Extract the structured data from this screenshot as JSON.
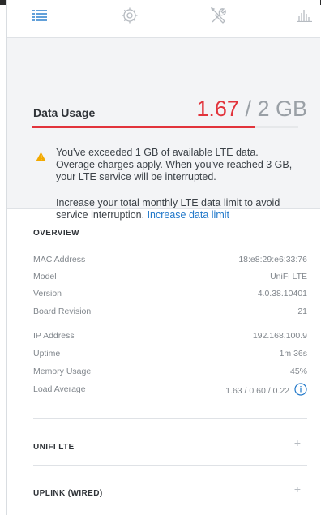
{
  "toolbar": {
    "icons": [
      "list-icon",
      "gear-icon",
      "tools-icon",
      "stats-icon"
    ],
    "accent": "#1f77c9",
    "muted": "#b6bbc1"
  },
  "usage": {
    "title": "Data Usage",
    "used": "1.67",
    "separator": "/",
    "total": "2 GB",
    "used_fraction": 0.835,
    "bar_color": "#e2343c",
    "warning_text": "You've exceeded 1 GB of available LTE data. Overage charges apply. When you've reached 3 GB, your LTE service will be interrupted.",
    "advice_text": "Increase your total monthly LTE data limit to avoid service interruption.",
    "link_text": "Increase data limit",
    "warning_color": "#f2a900"
  },
  "overview": {
    "title": "OVERVIEW",
    "toggle": "—",
    "rows": [
      {
        "key": "MAC Address",
        "value": "18:e8:29:e6:33:76"
      },
      {
        "key": "Model",
        "value": "UniFi LTE"
      },
      {
        "key": "Version",
        "value": "4.0.38.10401"
      },
      {
        "key": "Board Revision",
        "value": "21"
      },
      {
        "key": "IP Address",
        "value": "192.168.100.9"
      },
      {
        "key": "Uptime",
        "value": "1m 36s"
      },
      {
        "key": "Memory Usage",
        "value": "45%"
      },
      {
        "key": "Load Average",
        "value": "1.63 / 0.60 / 0.22"
      }
    ]
  },
  "unifi_lte": {
    "title": "UNIFI LTE",
    "toggle": "+"
  },
  "uplink": {
    "title": "UPLINK (WIRED)",
    "toggle": "+"
  }
}
